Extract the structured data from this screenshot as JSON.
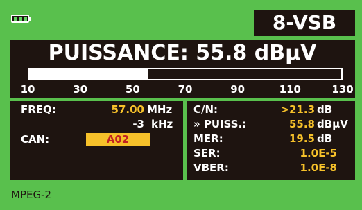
{
  "status": {
    "battery_icon": "battery-icon",
    "mode": "8-VSB"
  },
  "power": {
    "title": "PUISSANCE: 55.8 dBµV",
    "level_fraction": 0.38,
    "scale": [
      "10",
      "30",
      "50",
      "70",
      "90",
      "110",
      "130"
    ]
  },
  "tuning": {
    "freq_label": "FREQ:",
    "freq_value": "57.00",
    "freq_unit": "MHz",
    "offset_value": "-3",
    "offset_unit": "kHz",
    "channel_label": "CAN:",
    "channel_value": "A02"
  },
  "measurements": {
    "cn_label": "C/N:",
    "cn_value": ">21.3",
    "cn_unit": "dB",
    "power_label": "» PUISS.:",
    "power_value": "55.8",
    "power_unit": "dBµV",
    "mer_label": "MER:",
    "mer_value": "19.5",
    "mer_unit": "dB",
    "ser_label": "SER:",
    "ser_value": "1.0E-5",
    "vber_label": "VBER:",
    "vber_value": "1.0E-8"
  },
  "footer": {
    "text": "MPEG-2"
  },
  "colors": {
    "background": "#59c04d",
    "panel": "#1e1410",
    "value": "#f6c12a",
    "channel_text": "#c22222"
  }
}
